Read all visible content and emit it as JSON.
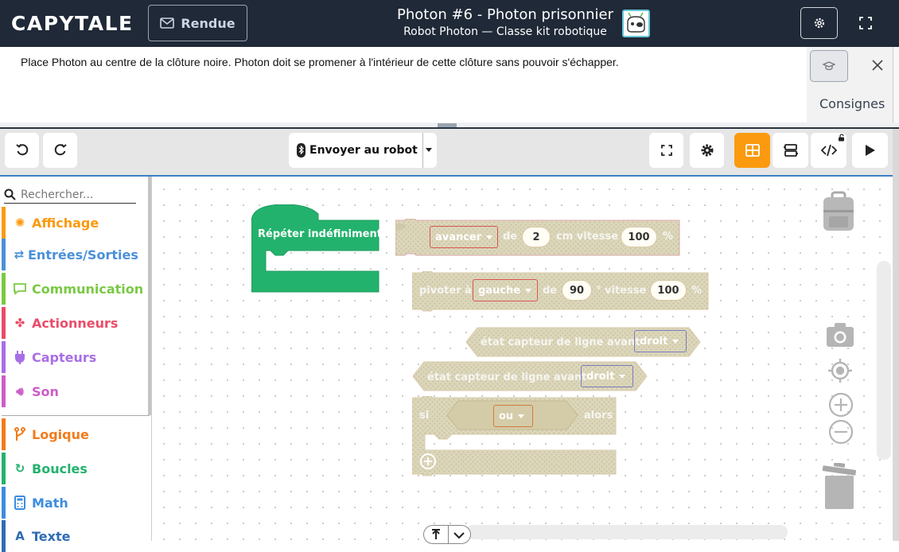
{
  "header": {
    "logo": "CAPYTALE",
    "rendue_label": "Rendue",
    "title": "Photon #6 - Photon prisonnier",
    "subtitle": "Robot Photon — Classe kit robotique"
  },
  "instructions": {
    "text": "Place Photon au centre de la clôture noire. Photon doit se promener à l'intérieur de cette clôture sans pouvoir s'échapper."
  },
  "side_panel": {
    "consignes_label": "Consignes"
  },
  "toolbar": {
    "send_label": "Envoyer au robot"
  },
  "toolbox": {
    "search_placeholder": "Rechercher...",
    "categories": [
      {
        "label": "Affichage",
        "color": "#fb9a0e"
      },
      {
        "label": "Entrées/Sorties",
        "color": "#4a90d9"
      },
      {
        "label": "Communication",
        "color": "#7ac943"
      },
      {
        "label": "Actionneurs",
        "color": "#ea4c6a"
      },
      {
        "label": "Capteurs",
        "color": "#a86ee6"
      },
      {
        "label": "Son",
        "color": "#cc5ec8"
      },
      {
        "label": "Logique",
        "color": "#f27b1c"
      },
      {
        "label": "Boucles",
        "color": "#23b26d"
      },
      {
        "label": "Math",
        "color": "#3c8de0"
      },
      {
        "label": "Texte",
        "color": "#2f6db3"
      }
    ]
  },
  "blocks": {
    "repeat_label": "Répéter indéfiniment",
    "move": {
      "action": "avancer",
      "de": "de",
      "distance": "2",
      "unit": "cm vitesse",
      "speed": "100",
      "pct": "%"
    },
    "turn": {
      "action": "pivoter à",
      "direction": "gauche",
      "de": "de",
      "angle": "90",
      "unit": "° vitesse",
      "speed": "100",
      "pct": "%"
    },
    "sensor1": {
      "label": "état capteur de ligne  avant",
      "side": "droit"
    },
    "sensor2": {
      "label": "état capteur de ligne  avant",
      "side": "droit"
    },
    "if": {
      "si": "si",
      "op": "ou",
      "alors": "alors"
    }
  },
  "colors": {
    "topbar": "#1f2937",
    "accent_orange": "#fb9a0e",
    "loop_green": "#23b26d",
    "disabled_block": "#d9d3b8"
  }
}
